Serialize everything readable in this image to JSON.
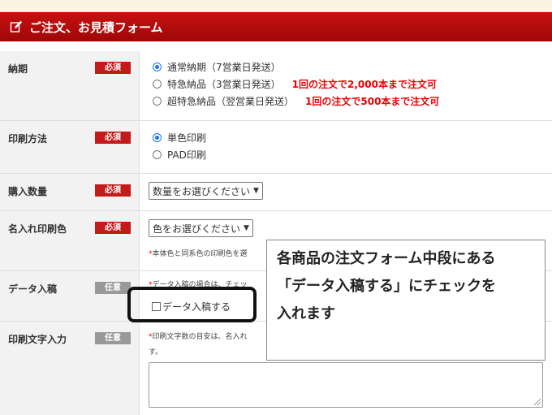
{
  "header": {
    "title": "ご注文、お見積フォーム",
    "icon": "edit-icon"
  },
  "badges": {
    "required": "必須",
    "optional": "任意"
  },
  "delivery": {
    "label": "納期",
    "options": [
      {
        "text": "通常納期（7営業日発送）",
        "note": ""
      },
      {
        "text": "特急納品（3営業日発送）",
        "note": "1回の注文で2,000本まで注文可"
      },
      {
        "text": "超特急納品（翌営業日発送）",
        "note": "1回の注文で500本まで注文可"
      }
    ]
  },
  "print_method": {
    "label": "印刷方法",
    "options": [
      "単色印刷",
      "PAD印刷"
    ]
  },
  "quantity": {
    "label": "購入数量",
    "select_value": "数量をお選びください"
  },
  "color": {
    "label": "名入れ印刷色",
    "select_value": "色をお選びください",
    "note": "本体色と同系色の印刷色を選"
  },
  "data_entry": {
    "label": "データ入稿",
    "note": "データ入稿の場合は、チェッ",
    "checkbox_label": "データ入稿する"
  },
  "print_text": {
    "label": "印刷文字入力",
    "note_line1": "印刷文字数の目安は、名入れ",
    "note_line2": "す。"
  },
  "callout": {
    "lines": [
      "各商品の注文フォーム中段にある",
      "「データ入稿する」にチェックを",
      "入れます"
    ]
  },
  "colors": {
    "header_red": "#c80f0f",
    "required_badge": "#c41a1a",
    "optional_badge": "#999999",
    "warning_text": "#ee0000",
    "radio_blue": "#1a73e8"
  }
}
